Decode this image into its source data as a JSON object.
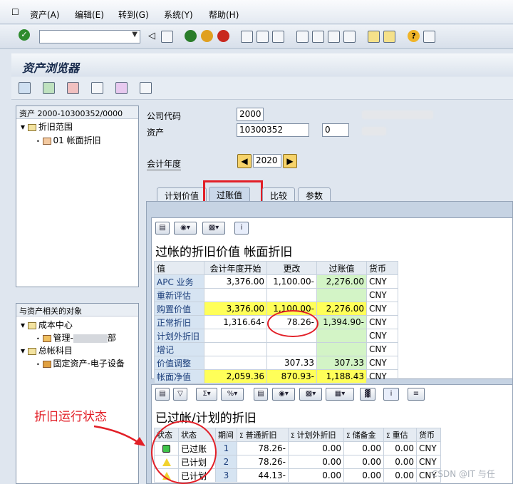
{
  "menu": [
    "资产(A)",
    "编辑(E)",
    "转到(G)",
    "系统(Y)",
    "帮助(H)"
  ],
  "page_title": "资产浏览器",
  "tree": {
    "root": "资产 2000-10300352/0000",
    "node1": "折旧范围",
    "node1_child": "01  帐面折旧"
  },
  "tree2": {
    "header": "与资产相关的对象",
    "cost_center": "成本中心",
    "cost_center_child_a": "管理-",
    "cost_center_child_b": "部",
    "gl_account": "总帐科目",
    "gl_child": "固定资产-电子设备"
  },
  "form": {
    "company_code_label": "公司代码",
    "company_code": "2000",
    "asset_label": "资产",
    "asset": "10300352",
    "subnumber": "0",
    "fiscal_year_label": "会计年度",
    "fiscal_year": "2020"
  },
  "tabs": [
    "计划价值",
    "过账值",
    "比较",
    "参数"
  ],
  "table1": {
    "title": "过帐的折旧价值 帐面折旧",
    "headers": [
      "值",
      "会计年度开始",
      "更改",
      "过账值",
      "货币"
    ],
    "rows": [
      [
        "APC 业务",
        "3,376.00",
        "1,100.00-",
        "2,276.00",
        "CNY"
      ],
      [
        "重新评估",
        "",
        "",
        "",
        "CNY"
      ],
      [
        "购置价值",
        "3,376.00",
        "1,100.00-",
        "2,276.00",
        "CNY"
      ],
      [
        "正常折旧",
        "1,316.64-",
        "78.26-",
        "1,394.90-",
        "CNY"
      ],
      [
        "计划外折旧",
        "",
        "",
        "",
        "CNY"
      ],
      [
        "增记",
        "",
        "",
        "",
        "CNY"
      ],
      [
        "价值调整",
        "",
        "307.33",
        "307.33",
        "CNY"
      ],
      [
        "帐面净值",
        "2,059.36",
        "870.93-",
        "1,188.43",
        "CNY"
      ]
    ]
  },
  "table2": {
    "title": "已过帐/计划的折旧",
    "headers": [
      "状态",
      "状态",
      "期间",
      "普通折旧",
      "计划外折旧",
      "储备金",
      "重估",
      "货币"
    ],
    "rows": [
      [
        "已过账",
        "1",
        "78.26-",
        "0.00",
        "0.00",
        "0.00",
        "CNY"
      ],
      [
        "已计划",
        "2",
        "78.26-",
        "0.00",
        "0.00",
        "0.00",
        "CNY"
      ],
      [
        "已计划",
        "3",
        "44.13-",
        "0.00",
        "0.00",
        "0.00",
        "CNY"
      ]
    ]
  },
  "annotation": "折旧运行状态",
  "watermark": "CSDN @IT 与任",
  "colors": {
    "accent_red": "#e21f27",
    "yellow_row": "#ffff59",
    "green_col": "#d3f4c6"
  }
}
